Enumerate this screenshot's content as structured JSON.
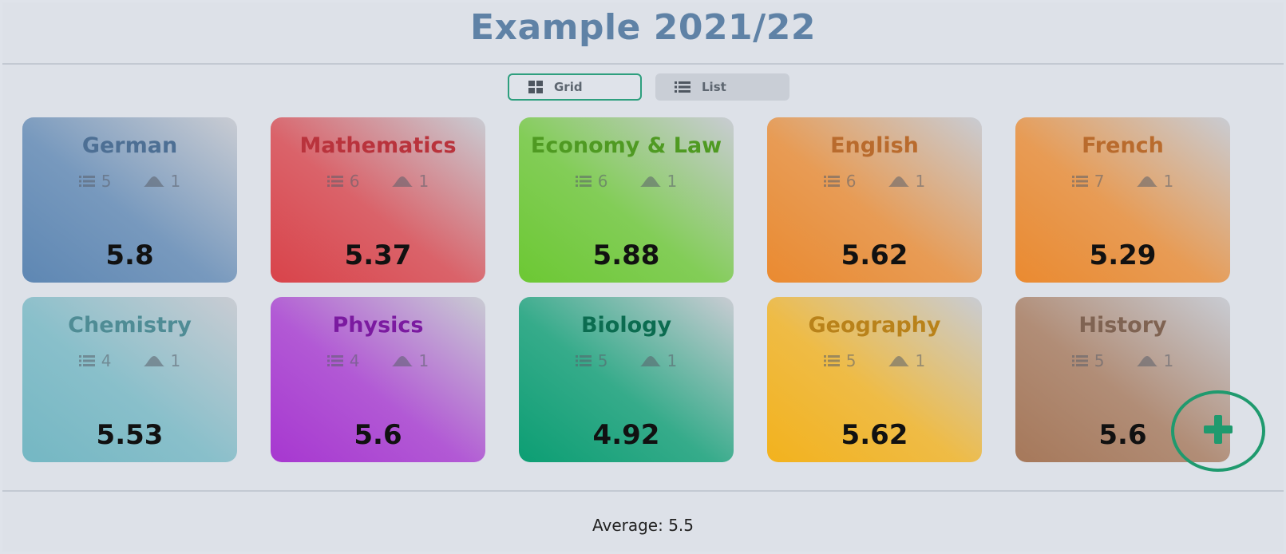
{
  "header": {
    "title": "Example 2021/22"
  },
  "view_toggle": {
    "grid_label": "Grid",
    "list_label": "List",
    "selected": "Grid"
  },
  "subjects": [
    {
      "name": "German",
      "exams": "5",
      "tests": "1",
      "grade": "5.8",
      "color": "#5e87b3",
      "text_color": "#4d6f94"
    },
    {
      "name": "Mathematics",
      "exams": "6",
      "tests": "1",
      "grade": "5.37",
      "color": "#d9434a",
      "text_color": "#b9333c"
    },
    {
      "name": "Economy & Law",
      "exams": "6",
      "tests": "1",
      "grade": "5.88",
      "color": "#6cc833",
      "text_color": "#4f9a22"
    },
    {
      "name": "English",
      "exams": "6",
      "tests": "1",
      "grade": "5.62",
      "color": "#ea8a30",
      "text_color": "#b96b2d"
    },
    {
      "name": "French",
      "exams": "7",
      "tests": "1",
      "grade": "5.29",
      "color": "#ea8a30",
      "text_color": "#b96b2d"
    },
    {
      "name": "Chemistry",
      "exams": "4",
      "tests": "1",
      "grade": "5.53",
      "color": "#74b7c3",
      "text_color": "#4f8c95"
    },
    {
      "name": "Physics",
      "exams": "4",
      "tests": "1",
      "grade": "5.6",
      "color": "#a737d0",
      "text_color": "#7b1aa0"
    },
    {
      "name": "Biology",
      "exams": "5",
      "tests": "1",
      "grade": "4.92",
      "color": "#0c9e73",
      "text_color": "#0b6c50"
    },
    {
      "name": "Geography",
      "exams": "5",
      "tests": "1",
      "grade": "5.62",
      "color": "#f3b21d",
      "text_color": "#b9821a"
    },
    {
      "name": "History",
      "exams": "5",
      "tests": "1",
      "grade": "5.6",
      "color": "#a6785a",
      "text_color": "#7f6352"
    }
  ],
  "footer": {
    "average_text": "Average: 5.5"
  },
  "fab": {
    "icon": "plus-icon",
    "color": "#1f9a6e"
  }
}
